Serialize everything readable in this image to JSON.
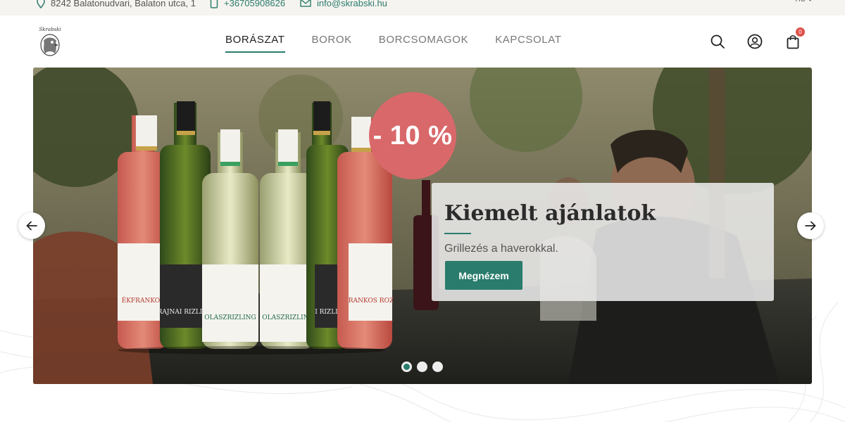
{
  "topbar": {
    "address": "8242 Balatonudvari, Balaton utca, 1",
    "phone": "+36705908626",
    "email": "info@skrabski.hu",
    "language": "HU",
    "icons": [
      "map-pin-icon",
      "phone-icon",
      "envelope-icon",
      "chevron-down-icon"
    ]
  },
  "header": {
    "logo_alt": "Skrabski",
    "nav": [
      {
        "label": "BORÁSZAT",
        "active": true
      },
      {
        "label": "BOROK",
        "active": false
      },
      {
        "label": "BORCSOMAGOK",
        "active": false
      },
      {
        "label": "KAPCSOLAT",
        "active": false
      }
    ],
    "icons": [
      "search-icon",
      "user-icon",
      "shopping-bag-icon"
    ],
    "cart_count": "0"
  },
  "hero": {
    "discount": "- 10 %",
    "title": "Kiemelt ajánlatok",
    "subtitle": "Grillezés a haverokkal.",
    "button": "Megnézem",
    "slides": 3,
    "active_slide": 1,
    "bottle_labels": [
      "KÉKFRANKOS",
      "RAJNAI RIZLING",
      "OLASZRIZLING",
      "OLASZRIZLING",
      "RAJNAI RIZLING",
      "KÉKFRANKOS ROZÉ"
    ]
  },
  "colors": {
    "accent": "#2a7c6c",
    "discount": "#d9686a",
    "badge": "#e0504a",
    "topbar_bg": "#f6f4f0"
  }
}
